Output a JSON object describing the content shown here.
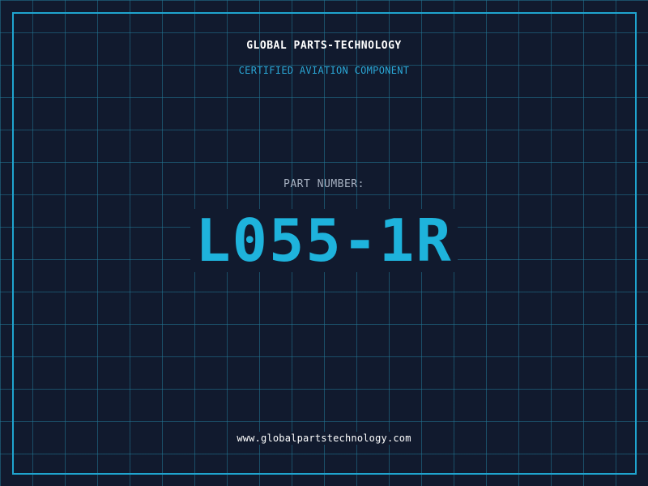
{
  "header": {
    "company": "GLOBAL PARTS-TECHNOLOGY",
    "tagline": "CERTIFIED AVIATION COMPONENT"
  },
  "part": {
    "label": "PART NUMBER:",
    "number": "L055-1R"
  },
  "footer": {
    "url": "www.globalpartstechnology.com"
  },
  "colors": {
    "background": "#111a2e",
    "grid": "#22788f",
    "frame": "#1fa4cf",
    "accent": "#1eb3dc",
    "label": "#a6b0c0",
    "text": "#ffffff"
  }
}
